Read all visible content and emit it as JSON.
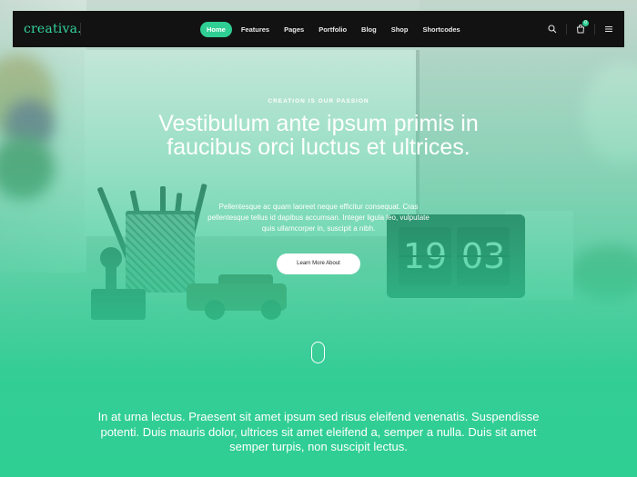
{
  "brand": {
    "logo": "creativa.",
    "accent": "#2fcf94"
  },
  "nav": {
    "items": [
      {
        "label": "Home",
        "active": true
      },
      {
        "label": "Features",
        "active": false
      },
      {
        "label": "Pages",
        "active": false
      },
      {
        "label": "Portfolio",
        "active": false
      },
      {
        "label": "Blog",
        "active": false
      },
      {
        "label": "Shop",
        "active": false
      },
      {
        "label": "Shortcodes",
        "active": false
      }
    ],
    "icons": [
      "search-icon",
      "cart-icon",
      "menu-icon"
    ],
    "cart_count": "0"
  },
  "hero": {
    "eyebrow": "CREATION IS OUR PASSION",
    "headline": "Vestibulum ante ipsum primis in faucibus orci luctus et ultrices.",
    "lead": "Pellentesque ac quam laoreet neque efficitur consequat. Cras pellentesque tellus id dapibus accumsan. Integer ligula leo, vulputate quis ullamcorper in, suscipit a nibh.",
    "cta": "Learn More About"
  },
  "clock": {
    "hours": "19",
    "minutes": "03"
  },
  "intro": "In at urna lectus. Praesent sit amet ipsum sed risus eleifend venenatis. Suspendisse potenti. Duis mauris dolor, ultrices sit amet eleifend a, semper a nulla. Duis sit amet semper turpis, non suscipit lectus."
}
